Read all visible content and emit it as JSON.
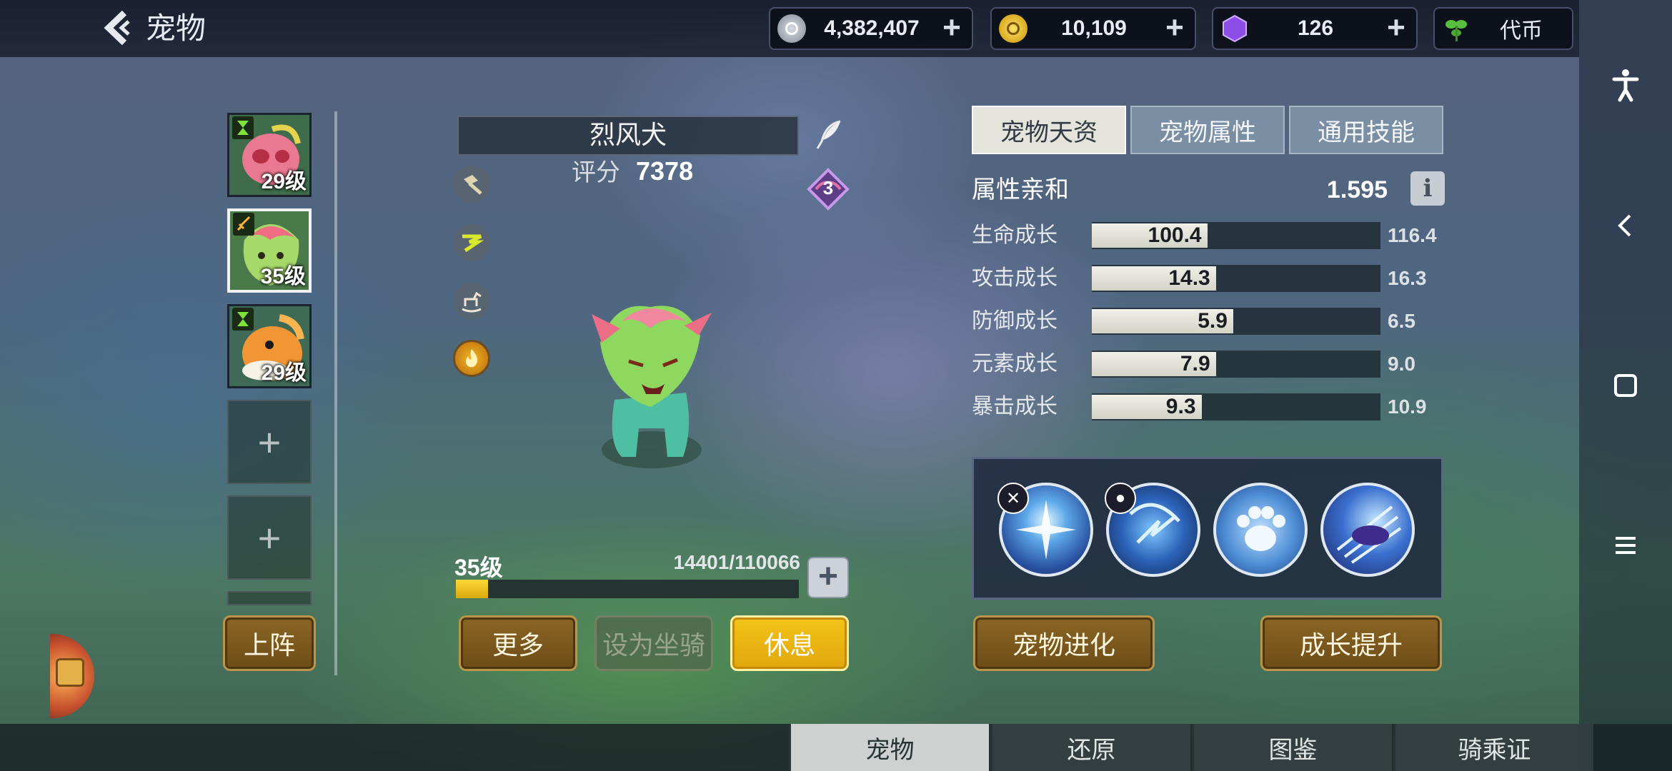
{
  "header": {
    "title": "宠物",
    "back_icon": "back-chevron-icon"
  },
  "currencies": [
    {
      "name": "silver",
      "icon": "silver-coin-icon",
      "value": "4,382,407",
      "color": "#a6acb6"
    },
    {
      "name": "gold",
      "icon": "gold-coin-icon",
      "value": "10,109",
      "color": "#e5b719"
    },
    {
      "name": "gem",
      "icon": "purple-gem-icon",
      "value": "126",
      "color": "#8a4de0"
    },
    {
      "name": "token",
      "icon": "sprout-icon",
      "value": "代币",
      "color": "#4fb33a"
    }
  ],
  "pets": [
    {
      "level": "29级",
      "badge": "hourglass-icon",
      "selected": false,
      "color": "#e7748c"
    },
    {
      "level": "35级",
      "badge": "sword-icon",
      "selected": true,
      "color": "#9ed26b"
    },
    {
      "level": "29级",
      "badge": "hourglass-icon",
      "selected": false,
      "color": "#f09b3b"
    }
  ],
  "empty_slot_symbol": "+",
  "left_button": "上阵",
  "pet": {
    "name": "烈风犬",
    "score_label": "评分",
    "score": "7378",
    "rank_badge": "3",
    "level": "35级",
    "exp": "14401/110066",
    "exp_fraction": 0.13
  },
  "side_icons": [
    "hammer-icon",
    "wind-element-icon",
    "rocking-horse-icon",
    "fire-orb-icon"
  ],
  "actions": {
    "more": "更多",
    "mount": "设为坐骑",
    "rest": "休息"
  },
  "tabs": [
    "宠物天资",
    "宠物属性",
    "通用技能"
  ],
  "affinity": {
    "label": "属性亲和",
    "value": "1.595",
    "info": "i"
  },
  "stats": [
    {
      "label": "生命成长",
      "current": 100.4,
      "max": 116.4,
      "current_text": "100.4",
      "max_text": "116.4"
    },
    {
      "label": "攻击成长",
      "current": 14.3,
      "max": 16.3,
      "current_text": "14.3",
      "max_text": "16.3"
    },
    {
      "label": "防御成长",
      "current": 5.9,
      "max": 6.5,
      "current_text": "5.9",
      "max_text": "6.5"
    },
    {
      "label": "元素成长",
      "current": 7.9,
      "max": 9.0,
      "current_text": "7.9",
      "max_text": "9.0"
    },
    {
      "label": "暴击成长",
      "current": 9.3,
      "max": 10.9,
      "current_text": "9.3",
      "max_text": "10.9"
    }
  ],
  "skills": [
    "burst-skill-icon",
    "lightning-skill-icon",
    "paw-skill-icon",
    "dash-skill-icon"
  ],
  "bottom_buttons": {
    "evolve": "宠物进化",
    "growth": "成长提升"
  },
  "bottom_tabs": [
    "宠物",
    "还原",
    "图鉴",
    "骑乘证"
  ],
  "system_nav": [
    "accessibility-icon",
    "back-icon",
    "home-icon",
    "menu-icon"
  ]
}
